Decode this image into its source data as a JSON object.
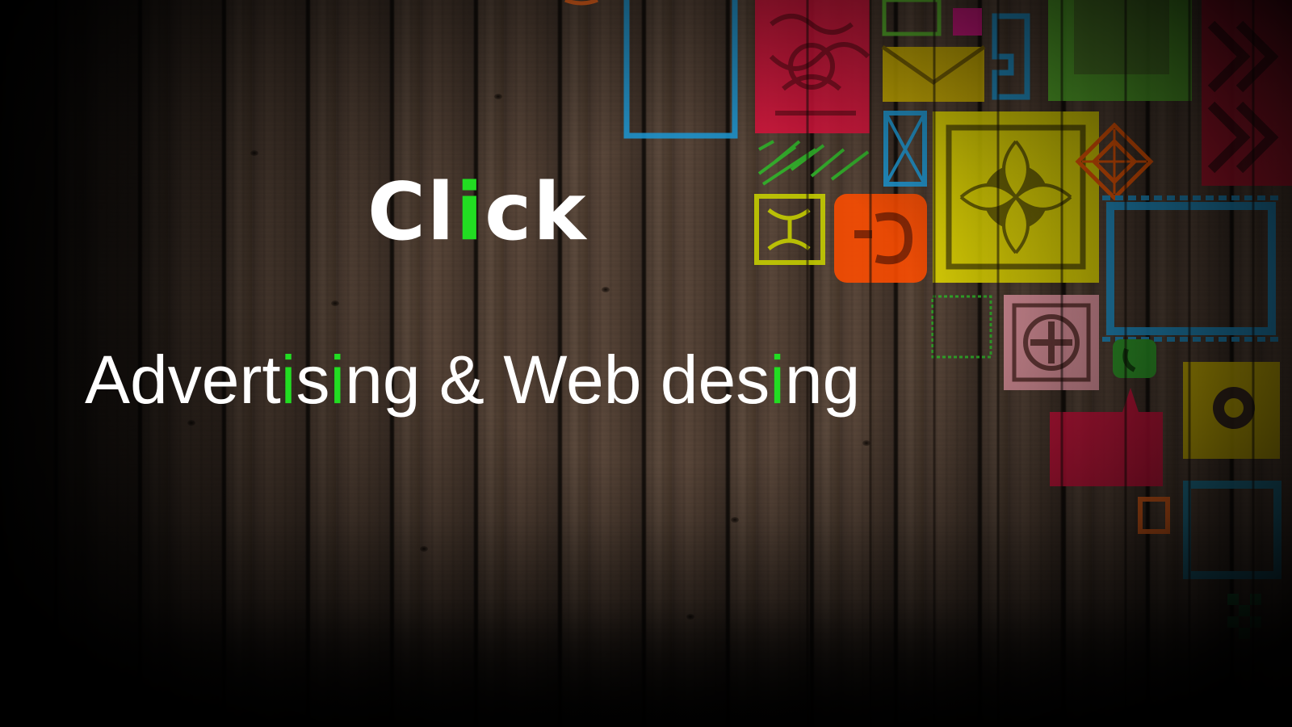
{
  "slide": {
    "logo": {
      "parts": [
        "Cl",
        "i",
        "ck"
      ]
    },
    "tagline": {
      "parts": [
        "Advert",
        "i",
        "s",
        "i",
        "ng & Web des",
        "i",
        "ng"
      ]
    }
  },
  "colors": {
    "text": "#ffffff",
    "accent": "#22dd22",
    "wood": "#4a3a30",
    "decor_blue": "#1e9ad6",
    "decor_red": "#e0153f",
    "decor_yellow": "#f2dc00",
    "decor_green": "#5cc12d",
    "decor_orange": "#ff5a00",
    "decor_pink": "#e99aa6"
  },
  "icons": [
    "wood-background",
    "colorful-pattern-decor"
  ]
}
